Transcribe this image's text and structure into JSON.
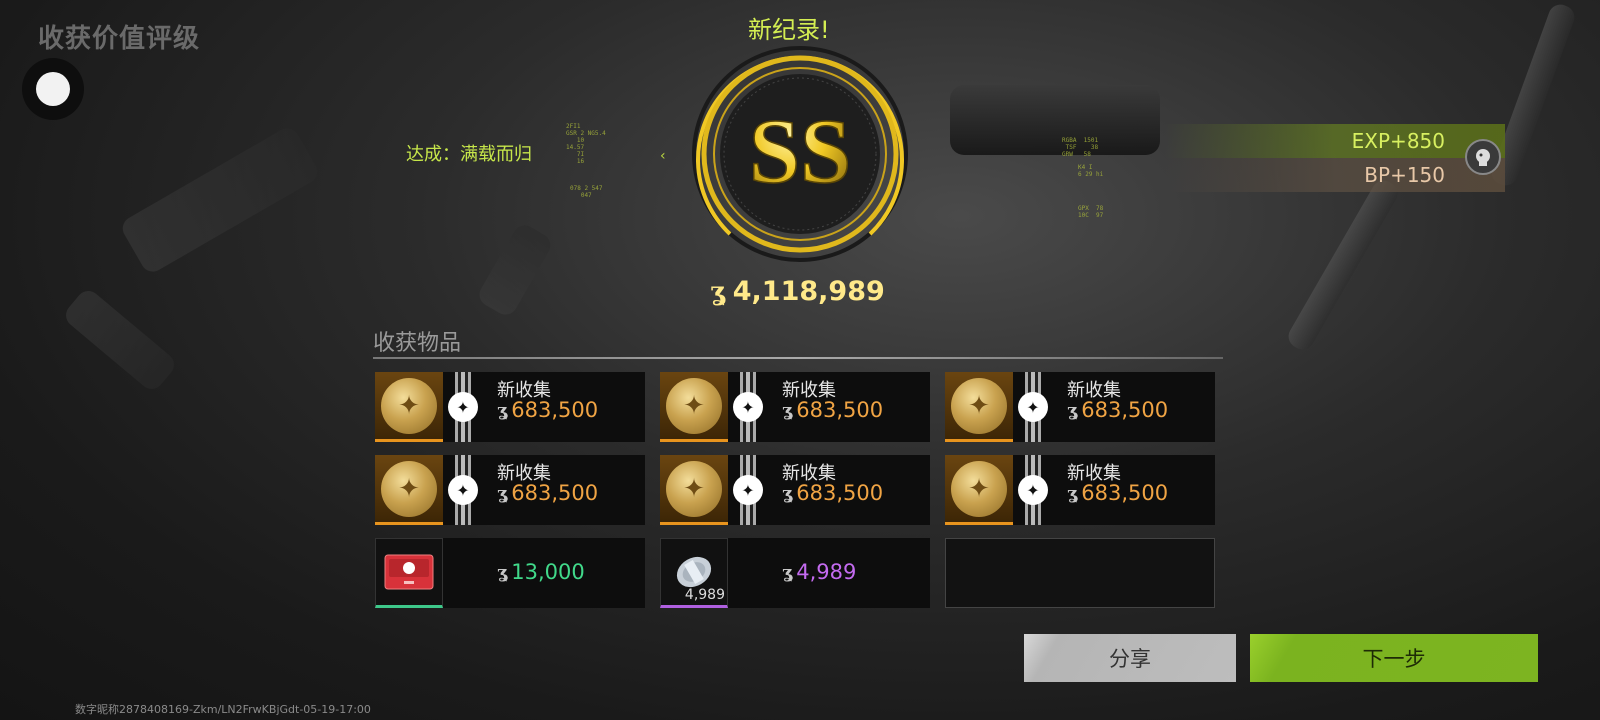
{
  "header": {
    "title": "收获价值评级",
    "new_record": "新纪录!",
    "achievement": "达成：满载而归"
  },
  "hud": {
    "left_block_1": "2FI1\nGSR 2 NG5.4\n   10\n14.57\n   7I\n   16",
    "left_block_2": "078 2 547\n   047",
    "right_block_1": "RGBA  1501\n TSF    38\nGRW   58",
    "right_block_2": "K4 I\n6 29 hi",
    "right_block_3": "GPX  78\n10C  97"
  },
  "rank": {
    "letters": "SS",
    "color": "#f0c824"
  },
  "total_value": {
    "icon": "coin-icon",
    "amount": "4,118,989"
  },
  "rewards": {
    "exp": "EXP+850",
    "bp": "BP+150"
  },
  "items_section": {
    "title": "收获物品",
    "items": [
      {
        "label": "新收集",
        "value": "683,500",
        "color": "orange",
        "icon": "medal-icon"
      },
      {
        "label": "新收集",
        "value": "683,500",
        "color": "orange",
        "icon": "medal-icon"
      },
      {
        "label": "新收集",
        "value": "683,500",
        "color": "orange",
        "icon": "medal-icon"
      },
      {
        "label": "新收集",
        "value": "683,500",
        "color": "orange",
        "icon": "medal-icon"
      },
      {
        "label": "新收集",
        "value": "683,500",
        "color": "orange",
        "icon": "medal-icon"
      },
      {
        "label": "新收集",
        "value": "683,500",
        "color": "orange",
        "icon": "medal-icon"
      },
      {
        "label": "",
        "value": "13,000",
        "color": "green",
        "icon": "red-card-icon"
      },
      {
        "label": "",
        "value": "4,989",
        "color": "purple",
        "icon": "cash-roll-icon",
        "quantity": "4,989"
      }
    ]
  },
  "buttons": {
    "share": "分享",
    "next": "下一步"
  },
  "footer": "数字昵称2878408169-Zkm/LN2FrwKBjGdt-05-19-17:00",
  "colors": {
    "accent_green": "#7db421",
    "orange": "#f0a444",
    "green": "#41d98a",
    "purple": "#c46bf0",
    "gold": "#f0c824"
  }
}
